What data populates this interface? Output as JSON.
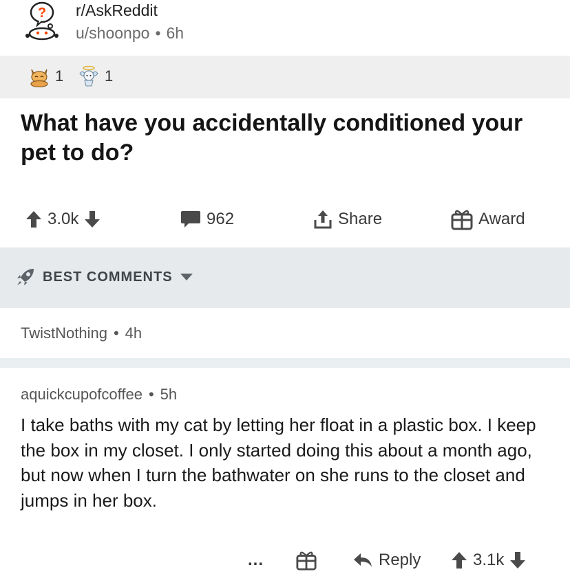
{
  "post": {
    "subreddit": "r/AskReddit",
    "user": "u/shoonpo",
    "age": "6h",
    "title": "What have you accidentally conditioned your pet to do?",
    "awards": [
      {
        "icon": "cat-award-icon",
        "count": "1"
      },
      {
        "icon": "angel-award-icon",
        "count": "1"
      }
    ],
    "actions": {
      "votes": "3.0k",
      "comments": "962",
      "share": "Share",
      "award": "Award"
    }
  },
  "sort": {
    "label": "BEST COMMENTS"
  },
  "comments": [
    {
      "user": "TwistNothing",
      "age": "4h"
    },
    {
      "user": "aquickcupofcoffee",
      "age": "5h",
      "body": "I take baths with my cat by letting her float in a plastic box. I keep the box in my closet. I only started doing this about a month ago, but now when I turn the bathwater on she runs to the closet and jumps in her box.",
      "actions": {
        "more": "...",
        "reply": "Reply",
        "votes": "3.1k"
      }
    }
  ],
  "meta_separator": "•"
}
